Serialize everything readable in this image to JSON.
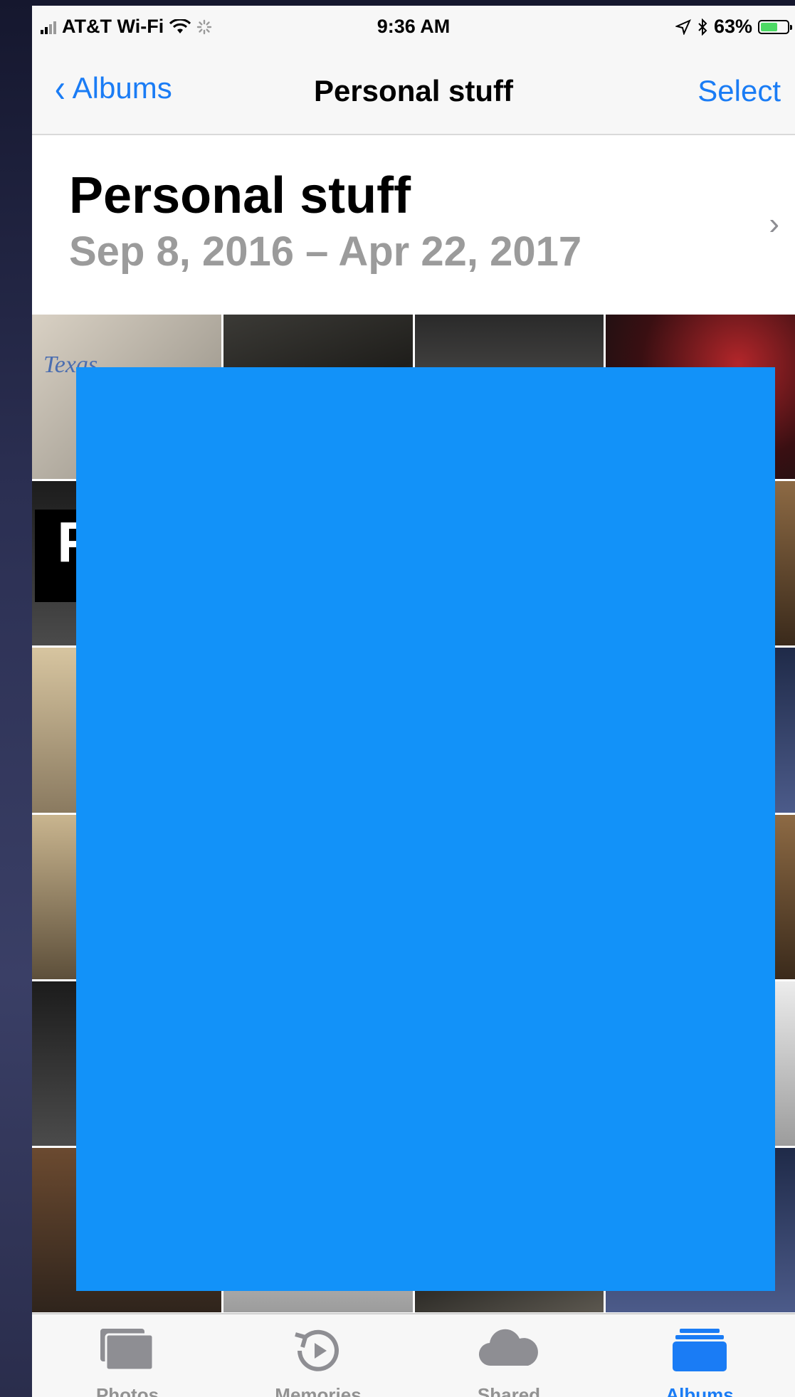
{
  "status_bar": {
    "carrier": "AT&T Wi-Fi",
    "time": "9:36 AM",
    "battery": "63%",
    "battery_level": 0.63,
    "battery_color": "#4cd964"
  },
  "nav_bar": {
    "back_label": "Albums",
    "title": "Personal stuff",
    "select_label": "Select",
    "accent_color": "#1a7cf5"
  },
  "album": {
    "title": "Personal stuff",
    "date_range": "Sep 8, 2016 – Apr 22, 2017"
  },
  "grid_tiles": {
    "texas_card_text": "Texas",
    "plate_text": "F"
  },
  "redaction_color": "#1292f9",
  "tab_bar": {
    "tabs": [
      {
        "label": "Photos",
        "icon": "photos-icon",
        "active": false
      },
      {
        "label": "Memories",
        "icon": "memories-icon",
        "active": false
      },
      {
        "label": "Shared",
        "icon": "cloud-icon",
        "active": false
      },
      {
        "label": "Albums",
        "icon": "albums-icon",
        "active": true
      }
    ]
  }
}
